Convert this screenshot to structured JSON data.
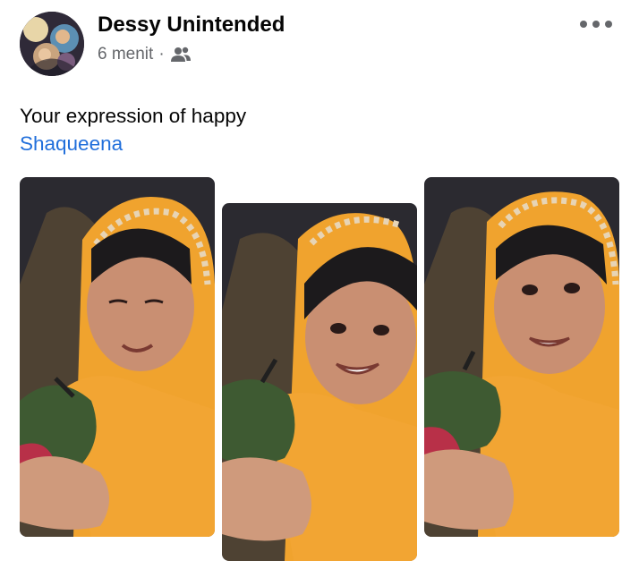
{
  "post": {
    "author": "Dessy Unintended",
    "timestamp": "6 menit",
    "separator": "·",
    "audience_icon": "friends-icon",
    "more_icon": "more-options-icon",
    "text": "Your expression of happy",
    "mention": "Shaqueena"
  },
  "photos": [
    {
      "name": "photo-1",
      "expression": "eyes-closed-smile"
    },
    {
      "name": "photo-2",
      "expression": "big-smile"
    },
    {
      "name": "photo-3",
      "expression": "looking-up-smile"
    }
  ],
  "colors": {
    "text": "#050505",
    "secondary": "#65676b",
    "link": "#216fdb",
    "hijab": "#f0a32e",
    "background_photo": "#2a2a30"
  }
}
